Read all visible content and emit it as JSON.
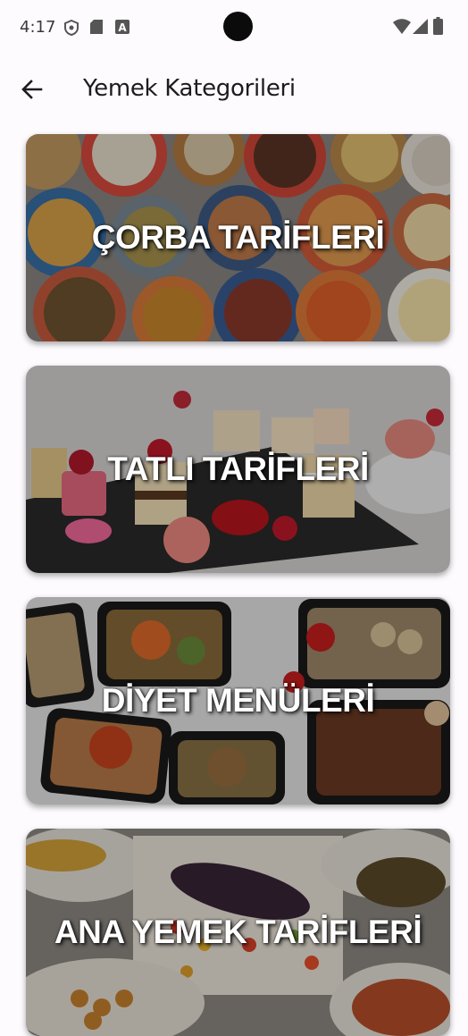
{
  "status_bar": {
    "time": "4:17",
    "icons": [
      "shield-icon",
      "sd-card-icon",
      "a-icon",
      "wifi-icon",
      "signal-icon",
      "battery-icon"
    ]
  },
  "app_bar": {
    "title": "Yemek Kategorileri",
    "back_icon": "arrow-back-icon"
  },
  "categories": [
    {
      "label": "ÇORBA TARİFLERİ",
      "image": "soups-photo"
    },
    {
      "label": "TATLI TARİFLERİ",
      "image": "desserts-photo"
    },
    {
      "label": "DİYET MENÜLERİ",
      "image": "diet-meals-photo"
    },
    {
      "label": "ANA YEMEK TARİFLERİ",
      "image": "main-dishes-photo"
    }
  ]
}
